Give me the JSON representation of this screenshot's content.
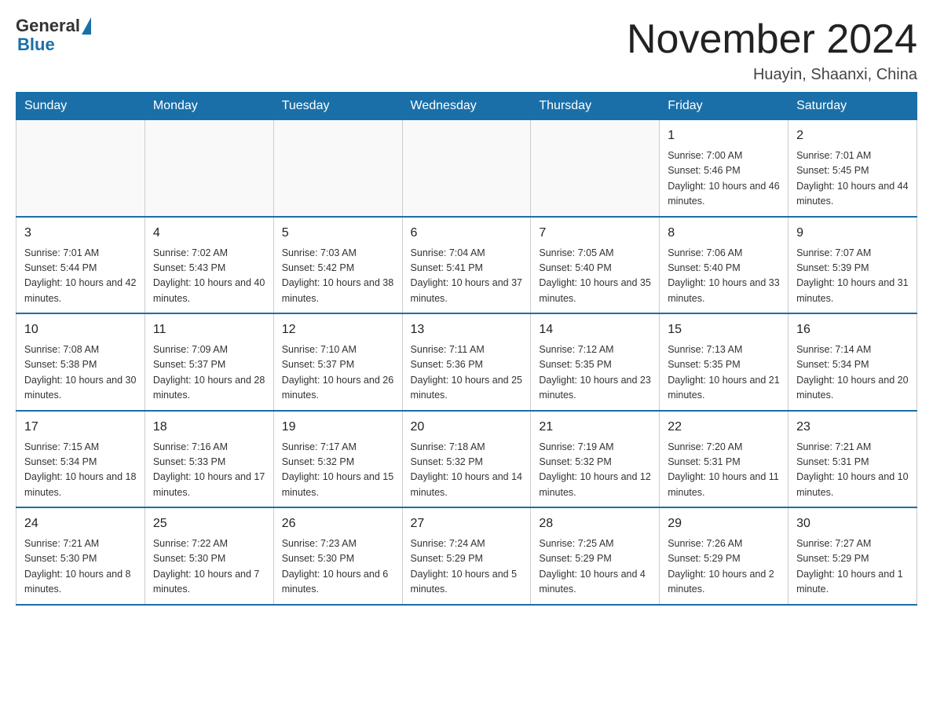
{
  "header": {
    "logo_general": "General",
    "logo_blue": "Blue",
    "month_title": "November 2024",
    "location": "Huayin, Shaanxi, China"
  },
  "days_of_week": [
    "Sunday",
    "Monday",
    "Tuesday",
    "Wednesday",
    "Thursday",
    "Friday",
    "Saturday"
  ],
  "weeks": [
    [
      {
        "day": "",
        "info": ""
      },
      {
        "day": "",
        "info": ""
      },
      {
        "day": "",
        "info": ""
      },
      {
        "day": "",
        "info": ""
      },
      {
        "day": "",
        "info": ""
      },
      {
        "day": "1",
        "info": "Sunrise: 7:00 AM\nSunset: 5:46 PM\nDaylight: 10 hours and 46 minutes."
      },
      {
        "day": "2",
        "info": "Sunrise: 7:01 AM\nSunset: 5:45 PM\nDaylight: 10 hours and 44 minutes."
      }
    ],
    [
      {
        "day": "3",
        "info": "Sunrise: 7:01 AM\nSunset: 5:44 PM\nDaylight: 10 hours and 42 minutes."
      },
      {
        "day": "4",
        "info": "Sunrise: 7:02 AM\nSunset: 5:43 PM\nDaylight: 10 hours and 40 minutes."
      },
      {
        "day": "5",
        "info": "Sunrise: 7:03 AM\nSunset: 5:42 PM\nDaylight: 10 hours and 38 minutes."
      },
      {
        "day": "6",
        "info": "Sunrise: 7:04 AM\nSunset: 5:41 PM\nDaylight: 10 hours and 37 minutes."
      },
      {
        "day": "7",
        "info": "Sunrise: 7:05 AM\nSunset: 5:40 PM\nDaylight: 10 hours and 35 minutes."
      },
      {
        "day": "8",
        "info": "Sunrise: 7:06 AM\nSunset: 5:40 PM\nDaylight: 10 hours and 33 minutes."
      },
      {
        "day": "9",
        "info": "Sunrise: 7:07 AM\nSunset: 5:39 PM\nDaylight: 10 hours and 31 minutes."
      }
    ],
    [
      {
        "day": "10",
        "info": "Sunrise: 7:08 AM\nSunset: 5:38 PM\nDaylight: 10 hours and 30 minutes."
      },
      {
        "day": "11",
        "info": "Sunrise: 7:09 AM\nSunset: 5:37 PM\nDaylight: 10 hours and 28 minutes."
      },
      {
        "day": "12",
        "info": "Sunrise: 7:10 AM\nSunset: 5:37 PM\nDaylight: 10 hours and 26 minutes."
      },
      {
        "day": "13",
        "info": "Sunrise: 7:11 AM\nSunset: 5:36 PM\nDaylight: 10 hours and 25 minutes."
      },
      {
        "day": "14",
        "info": "Sunrise: 7:12 AM\nSunset: 5:35 PM\nDaylight: 10 hours and 23 minutes."
      },
      {
        "day": "15",
        "info": "Sunrise: 7:13 AM\nSunset: 5:35 PM\nDaylight: 10 hours and 21 minutes."
      },
      {
        "day": "16",
        "info": "Sunrise: 7:14 AM\nSunset: 5:34 PM\nDaylight: 10 hours and 20 minutes."
      }
    ],
    [
      {
        "day": "17",
        "info": "Sunrise: 7:15 AM\nSunset: 5:34 PM\nDaylight: 10 hours and 18 minutes."
      },
      {
        "day": "18",
        "info": "Sunrise: 7:16 AM\nSunset: 5:33 PM\nDaylight: 10 hours and 17 minutes."
      },
      {
        "day": "19",
        "info": "Sunrise: 7:17 AM\nSunset: 5:32 PM\nDaylight: 10 hours and 15 minutes."
      },
      {
        "day": "20",
        "info": "Sunrise: 7:18 AM\nSunset: 5:32 PM\nDaylight: 10 hours and 14 minutes."
      },
      {
        "day": "21",
        "info": "Sunrise: 7:19 AM\nSunset: 5:32 PM\nDaylight: 10 hours and 12 minutes."
      },
      {
        "day": "22",
        "info": "Sunrise: 7:20 AM\nSunset: 5:31 PM\nDaylight: 10 hours and 11 minutes."
      },
      {
        "day": "23",
        "info": "Sunrise: 7:21 AM\nSunset: 5:31 PM\nDaylight: 10 hours and 10 minutes."
      }
    ],
    [
      {
        "day": "24",
        "info": "Sunrise: 7:21 AM\nSunset: 5:30 PM\nDaylight: 10 hours and 8 minutes."
      },
      {
        "day": "25",
        "info": "Sunrise: 7:22 AM\nSunset: 5:30 PM\nDaylight: 10 hours and 7 minutes."
      },
      {
        "day": "26",
        "info": "Sunrise: 7:23 AM\nSunset: 5:30 PM\nDaylight: 10 hours and 6 minutes."
      },
      {
        "day": "27",
        "info": "Sunrise: 7:24 AM\nSunset: 5:29 PM\nDaylight: 10 hours and 5 minutes."
      },
      {
        "day": "28",
        "info": "Sunrise: 7:25 AM\nSunset: 5:29 PM\nDaylight: 10 hours and 4 minutes."
      },
      {
        "day": "29",
        "info": "Sunrise: 7:26 AM\nSunset: 5:29 PM\nDaylight: 10 hours and 2 minutes."
      },
      {
        "day": "30",
        "info": "Sunrise: 7:27 AM\nSunset: 5:29 PM\nDaylight: 10 hours and 1 minute."
      }
    ]
  ]
}
